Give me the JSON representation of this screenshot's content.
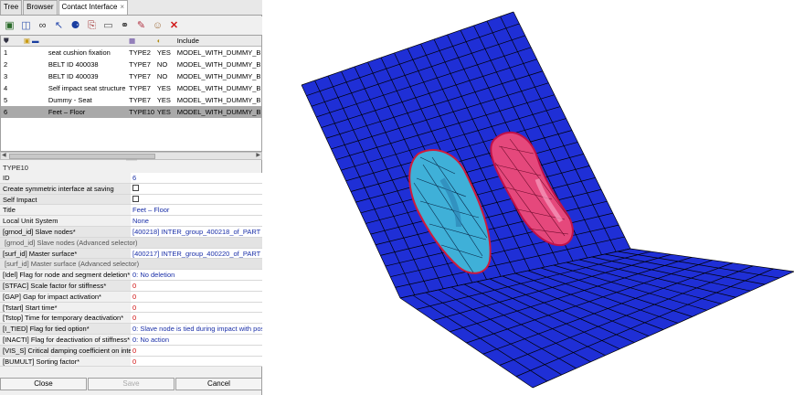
{
  "tabs": [
    {
      "label": "Tree"
    },
    {
      "label": "Browser"
    },
    {
      "label": "Contact Interface",
      "close": "×"
    }
  ],
  "toolbar_icons": [
    "add-interface-icon",
    "new-interface-icon",
    "glasses-icon",
    "pointer-icon",
    "nodes-icon",
    "export-icon",
    "blank-page-icon",
    "binoculars-icon",
    "edit-person-icon",
    "delete-icon"
  ],
  "list": {
    "headers": [
      "",
      "",
      "",
      "",
      "Include"
    ],
    "rows": [
      {
        "id": "1",
        "name": "seat cushion fixation",
        "type": "TYPE2",
        "active": "YES",
        "include": "MODEL_WITH_DUMMY_BE"
      },
      {
        "id": "2",
        "name": "BELT ID 400038",
        "type": "TYPE7",
        "active": "NO",
        "include": "MODEL_WITH_DUMMY_BE"
      },
      {
        "id": "3",
        "name": "BELT ID 400039",
        "type": "TYPE7",
        "active": "NO",
        "include": "MODEL_WITH_DUMMY_BE"
      },
      {
        "id": "4",
        "name": "Self impact seat structure",
        "type": "TYPE7",
        "active": "YES",
        "include": "MODEL_WITH_DUMMY_BE"
      },
      {
        "id": "5",
        "name": "Dummy - Seat",
        "type": "TYPE7",
        "active": "YES",
        "include": "MODEL_WITH_DUMMY_BE"
      },
      {
        "id": "6",
        "name": "Feet – Floor",
        "type": "TYPE10",
        "active": "YES",
        "include": "MODEL_WITH_DUMMY_BE",
        "selected": true
      }
    ]
  },
  "props": {
    "title": "TYPE10",
    "rows": [
      {
        "label": "ID",
        "value": "6"
      },
      {
        "label": "Create symmetric interface at saving",
        "value": "",
        "checkbox": true
      },
      {
        "label": "Self Impact",
        "value": "",
        "checkbox": true
      },
      {
        "label": "Title",
        "value": "Feet – Floor"
      },
      {
        "label": "Local Unit System",
        "value": "None"
      },
      {
        "label": "[grnod_id] Slave nodes*",
        "value": "[400218] INTER_group_400218_of_PART"
      },
      {
        "label": "[grnod_id] Slave nodes (Advanced selector)",
        "sub": true
      },
      {
        "label": "[surf_id] Master surface*",
        "value": "[400217] INTER_group_400220_of_PART"
      },
      {
        "label": "[surf_id] Master surface (Advanced selector)",
        "sub": true
      },
      {
        "label": "[Idel] Flag for node and segment deletion*",
        "value": "0: No deletion"
      },
      {
        "label": "[STFAC] Scale factor for stiffness*",
        "value": "0",
        "red": true
      },
      {
        "label": "[GAP] Gap for impact activation*",
        "value": "0",
        "red": true
      },
      {
        "label": "[Tstart] Start time*",
        "value": "0",
        "red": true
      },
      {
        "label": "[Tstop] Time for temporary deactivation*",
        "value": "0",
        "red": true
      },
      {
        "label": "[I_TIED] Flag for tied option*",
        "value": "0: Slave node is tied during impact with pos"
      },
      {
        "label": "[INACTI] Flag for deactivation of stiffness*",
        "value": "0: No action"
      },
      {
        "label": "[VIS_S] Critical damping coefficient on inter",
        "value": "0",
        "red": true
      },
      {
        "label": "[BUMULT] Sorting factor*",
        "value": "0",
        "red": true
      }
    ]
  },
  "buttons": {
    "close": "Close",
    "save": "Save",
    "cancel": "Cancel"
  },
  "colors": {
    "floor": "#1f2fd6",
    "mesh_line": "#000000",
    "left_foot": "#3fb0d8",
    "right_foot": "#e5487c",
    "selected_row": "#a9a9a9",
    "value_text": "#1a2fa8",
    "red_value": "#d01010"
  }
}
